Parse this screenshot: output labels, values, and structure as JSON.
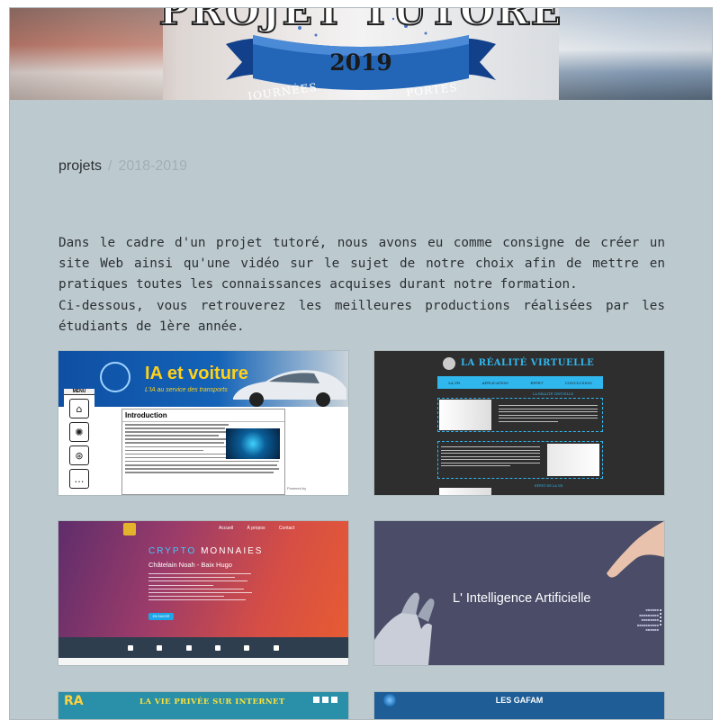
{
  "banner": {
    "title": "PROJET TUTORÉ",
    "year": "2019",
    "ribbon_left": "JOURNÉES",
    "ribbon_right": "PORTES"
  },
  "breadcrumb": {
    "parent": "projets",
    "separator": "/",
    "current": "2018-2019"
  },
  "intro": {
    "paragraph1": "Dans le cadre d'un projet tutoré, nous avons eu comme consigne de créer un site Web ainsi qu'une vidéo sur le sujet de notre choix afin de mettre en pratiques toutes les connaissances acquises durant notre formation.",
    "paragraph2": "Ci-dessous, vous retrouverez les meilleures productions réalisées par les étudiants de 1ère année."
  },
  "projects": [
    {
      "title": "IA et voiture",
      "subtitle": "L'IA au service des transports",
      "menu_label": "MENU",
      "section_title": "Introduction",
      "menu_icons": [
        "home-icon",
        "brain-icon",
        "steering-wheel-icon",
        "chat-icon"
      ],
      "powered": "Powered by"
    },
    {
      "title": "LA RÉALITÉ VIRTUELLE",
      "nav": [
        "LA VR",
        "APPLICATION",
        "EFFET",
        "CONCLUSION"
      ],
      "section1": "LA RÉALITÉ VIRTUELLE",
      "section3": "EFFET DE LA VR"
    },
    {
      "brand_a": "CRYPTO",
      "brand_b": "MONNAIES",
      "authors": "Châtelain Noah - Baix Hugo",
      "menu": [
        "Accueil",
        "À propos",
        "Contact"
      ],
      "button": "EN SAVOIR"
    },
    {
      "title": "L' Intelligence Artificielle"
    },
    {
      "logo": "RA",
      "title": "LA VIE PRIVÉE SUR INTERNET"
    },
    {
      "title": "LES GAFAM"
    }
  ],
  "colors": {
    "page_bg": "#bccacf",
    "text": "#2b2f33",
    "muted": "#a3aeb3"
  }
}
